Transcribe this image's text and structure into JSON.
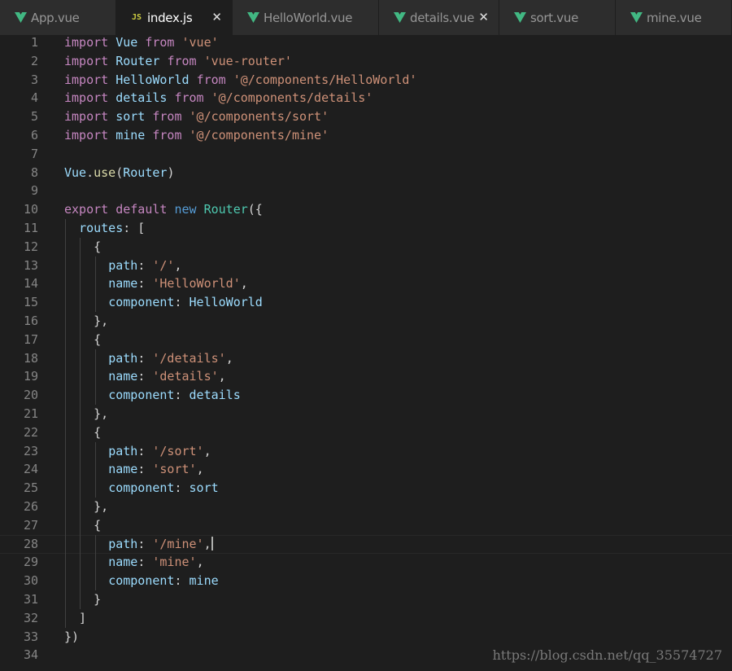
{
  "tabs": [
    {
      "label": "App.vue",
      "icon": "vue-icon",
      "active": false,
      "close": false
    },
    {
      "label": "index.js",
      "icon": "js-icon",
      "icon_text": "JS",
      "active": true,
      "close": true
    },
    {
      "label": "HelloWorld.vue",
      "icon": "vue-icon",
      "active": false,
      "close": false
    },
    {
      "label": "details.vue",
      "icon": "vue-icon",
      "active": false,
      "close": true
    },
    {
      "label": "sort.vue",
      "icon": "vue-icon",
      "active": false,
      "close": false
    },
    {
      "label": "mine.vue",
      "icon": "vue-icon",
      "active": false,
      "close": false
    }
  ],
  "colors": {
    "vue_green": "#42b883",
    "keyword": "#c586c0",
    "storage": "#569cd6",
    "string": "#ce9178",
    "variable": "#9cdcfe",
    "class": "#4ec9b0",
    "function": "#dcdcaa"
  },
  "editor": {
    "current_line": 28,
    "lines": [
      [
        [
          "kw",
          "import"
        ],
        [
          "pun",
          " "
        ],
        [
          "var",
          "Vue"
        ],
        [
          "pun",
          " "
        ],
        [
          "kw",
          "from"
        ],
        [
          "pun",
          " "
        ],
        [
          "str",
          "'vue'"
        ]
      ],
      [
        [
          "kw",
          "import"
        ],
        [
          "pun",
          " "
        ],
        [
          "var",
          "Router"
        ],
        [
          "pun",
          " "
        ],
        [
          "kw",
          "from"
        ],
        [
          "pun",
          " "
        ],
        [
          "str",
          "'vue-router'"
        ]
      ],
      [
        [
          "kw",
          "import"
        ],
        [
          "pun",
          " "
        ],
        [
          "var",
          "HelloWorld"
        ],
        [
          "pun",
          " "
        ],
        [
          "kw",
          "from"
        ],
        [
          "pun",
          " "
        ],
        [
          "str",
          "'@/components/HelloWorld'"
        ]
      ],
      [
        [
          "kw",
          "import"
        ],
        [
          "pun",
          " "
        ],
        [
          "var",
          "details"
        ],
        [
          "pun",
          " "
        ],
        [
          "kw",
          "from"
        ],
        [
          "pun",
          " "
        ],
        [
          "str",
          "'@/components/details'"
        ]
      ],
      [
        [
          "kw",
          "import"
        ],
        [
          "pun",
          " "
        ],
        [
          "var",
          "sort"
        ],
        [
          "pun",
          " "
        ],
        [
          "kw",
          "from"
        ],
        [
          "pun",
          " "
        ],
        [
          "str",
          "'@/components/sort'"
        ]
      ],
      [
        [
          "kw",
          "import"
        ],
        [
          "pun",
          " "
        ],
        [
          "var",
          "mine"
        ],
        [
          "pun",
          " "
        ],
        [
          "kw",
          "from"
        ],
        [
          "pun",
          " "
        ],
        [
          "str",
          "'@/components/mine'"
        ]
      ],
      [],
      [
        [
          "var",
          "Vue"
        ],
        [
          "pun",
          "."
        ],
        [
          "fn",
          "use"
        ],
        [
          "pun",
          "("
        ],
        [
          "var",
          "Router"
        ],
        [
          "pun",
          ")"
        ]
      ],
      [],
      [
        [
          "kw",
          "export"
        ],
        [
          "pun",
          " "
        ],
        [
          "kw",
          "default"
        ],
        [
          "pun",
          " "
        ],
        [
          "kb",
          "new"
        ],
        [
          "pun",
          " "
        ],
        [
          "cls",
          "Router"
        ],
        [
          "pun",
          "({"
        ]
      ],
      [
        [
          "pun",
          "  "
        ],
        [
          "var",
          "routes"
        ],
        [
          "pun",
          ": ["
        ]
      ],
      [
        [
          "pun",
          "    {"
        ]
      ],
      [
        [
          "pun",
          "      "
        ],
        [
          "var",
          "path"
        ],
        [
          "pun",
          ": "
        ],
        [
          "str",
          "'/'"
        ],
        [
          "pun",
          ","
        ]
      ],
      [
        [
          "pun",
          "      "
        ],
        [
          "var",
          "name"
        ],
        [
          "pun",
          ": "
        ],
        [
          "str",
          "'HelloWorld'"
        ],
        [
          "pun",
          ","
        ]
      ],
      [
        [
          "pun",
          "      "
        ],
        [
          "var",
          "component"
        ],
        [
          "pun",
          ": "
        ],
        [
          "var",
          "HelloWorld"
        ]
      ],
      [
        [
          "pun",
          "    },"
        ]
      ],
      [
        [
          "pun",
          "    {"
        ]
      ],
      [
        [
          "pun",
          "      "
        ],
        [
          "var",
          "path"
        ],
        [
          "pun",
          ": "
        ],
        [
          "str",
          "'/details'"
        ],
        [
          "pun",
          ","
        ]
      ],
      [
        [
          "pun",
          "      "
        ],
        [
          "var",
          "name"
        ],
        [
          "pun",
          ": "
        ],
        [
          "str",
          "'details'"
        ],
        [
          "pun",
          ","
        ]
      ],
      [
        [
          "pun",
          "      "
        ],
        [
          "var",
          "component"
        ],
        [
          "pun",
          ": "
        ],
        [
          "var",
          "details"
        ]
      ],
      [
        [
          "pun",
          "    },"
        ]
      ],
      [
        [
          "pun",
          "    {"
        ]
      ],
      [
        [
          "pun",
          "      "
        ],
        [
          "var",
          "path"
        ],
        [
          "pun",
          ": "
        ],
        [
          "str",
          "'/sort'"
        ],
        [
          "pun",
          ","
        ]
      ],
      [
        [
          "pun",
          "      "
        ],
        [
          "var",
          "name"
        ],
        [
          "pun",
          ": "
        ],
        [
          "str",
          "'sort'"
        ],
        [
          "pun",
          ","
        ]
      ],
      [
        [
          "pun",
          "      "
        ],
        [
          "var",
          "component"
        ],
        [
          "pun",
          ": "
        ],
        [
          "var",
          "sort"
        ]
      ],
      [
        [
          "pun",
          "    },"
        ]
      ],
      [
        [
          "pun",
          "    {"
        ]
      ],
      [
        [
          "pun",
          "      "
        ],
        [
          "var",
          "path"
        ],
        [
          "pun",
          ": "
        ],
        [
          "str",
          "'/mine'"
        ],
        [
          "pun",
          ","
        ]
      ],
      [
        [
          "pun",
          "      "
        ],
        [
          "var",
          "name"
        ],
        [
          "pun",
          ": "
        ],
        [
          "str",
          "'mine'"
        ],
        [
          "pun",
          ","
        ]
      ],
      [
        [
          "pun",
          "      "
        ],
        [
          "var",
          "component"
        ],
        [
          "pun",
          ": "
        ],
        [
          "var",
          "mine"
        ]
      ],
      [
        [
          "pun",
          "    }"
        ]
      ],
      [
        [
          "pun",
          "  ]"
        ]
      ],
      [
        [
          "pun",
          "})"
        ]
      ],
      []
    ]
  },
  "watermark": "https://blog.csdn.net/qq_35574727"
}
